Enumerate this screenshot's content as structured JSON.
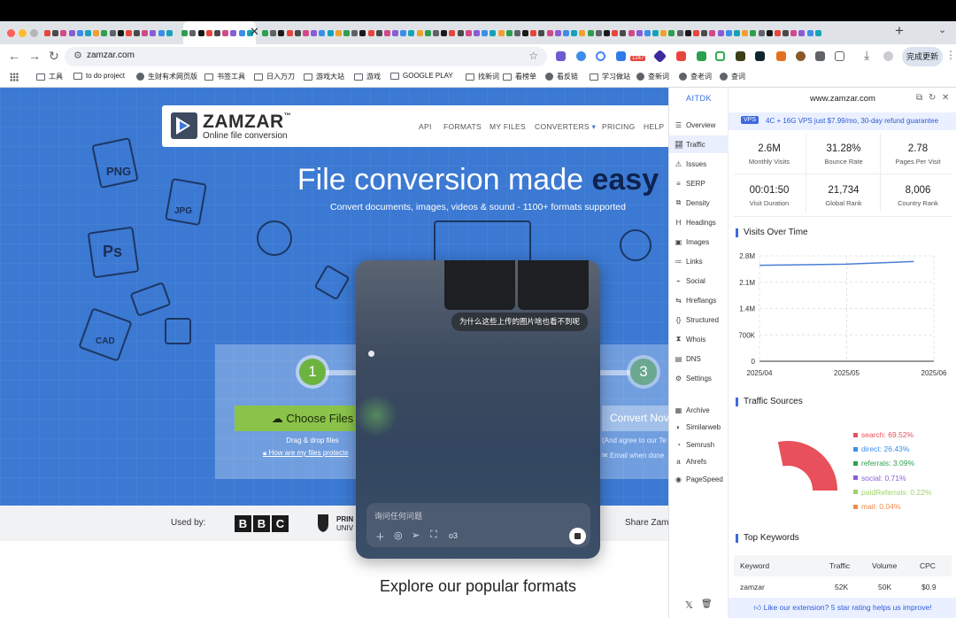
{
  "browser": {
    "url": "zamzar.com",
    "update_button": "完成更新",
    "ext_badge": "1247",
    "bookmarks": [
      {
        "label": "工具",
        "icon": "folder-icon"
      },
      {
        "label": "to do project",
        "icon": "folder-icon"
      },
      {
        "label": "生财有术网页版",
        "icon": "globe-icon"
      },
      {
        "label": "书签工具",
        "icon": "folder-icon"
      },
      {
        "label": "日入万刀",
        "icon": "folder-icon"
      },
      {
        "label": "游戏大站",
        "icon": "folder-icon"
      },
      {
        "label": "游戏",
        "icon": "folder-icon"
      },
      {
        "label": "GOOGLE PLAY",
        "icon": "folder-icon"
      },
      {
        "label": "找新词",
        "icon": "folder-icon"
      },
      {
        "label": "看榜单",
        "icon": "folder-icon"
      },
      {
        "label": "看反链",
        "icon": "globe-icon"
      },
      {
        "label": "学习做站",
        "icon": "folder-icon"
      },
      {
        "label": "查新词",
        "icon": "globe-icon"
      },
      {
        "label": "查老词",
        "icon": "globe-icon"
      },
      {
        "label": "查词",
        "icon": "globe-icon"
      }
    ]
  },
  "zamzar": {
    "logo": "ZAMZAR",
    "logo_tm": "™",
    "logo_sub": "Online file conversion",
    "nav": [
      "API",
      "FORMATS",
      "MY FILES",
      "CONVERTERS",
      "PRICING",
      "HELP"
    ],
    "hero_title": "File conversion made",
    "hero_title_bold": "easy",
    "hero_sub": "Convert documents, images, videos & sound - 1100+ formats supported",
    "doodles": [
      "PNG",
      "JPG",
      "Ps",
      "CAD"
    ],
    "step1": "1",
    "step3": "3",
    "choose_files": "Choose Files",
    "drag_drop": "Drag & drop files",
    "how_protected": "How are my files protecte",
    "convert_now": "Convert Nov",
    "agree": "(And agree to our Te",
    "email_when_done": "Email when done",
    "used_by": "Used by:",
    "bbc": [
      "B",
      "B",
      "C"
    ],
    "princeton_1": "PRIN",
    "princeton_2": "UNIV",
    "share": "Share Zam",
    "explore": "Explore our popular formats"
  },
  "overlay": {
    "bubble": "为什么这些上传的图片啥也看不到呢",
    "placeholder": "询问任何问题",
    "model": "o3"
  },
  "aitdk": {
    "brand": "AITDK",
    "domain": "www.zamzar.com",
    "vps_tag": "VPS",
    "vps_text": "4C + 16G VPS just $7.99/mo, 30-day refund guarantee",
    "nav": [
      {
        "label": "Overview",
        "icon": "overview-icon"
      },
      {
        "label": "Traffic",
        "icon": "traffic-icon"
      },
      {
        "label": "Issues",
        "icon": "warning-icon"
      },
      {
        "label": "SERP",
        "icon": "serp-icon"
      },
      {
        "label": "Density",
        "icon": "density-icon"
      },
      {
        "label": "Headings",
        "icon": "heading-icon"
      },
      {
        "label": "Images",
        "icon": "image-icon"
      },
      {
        "label": "Links",
        "icon": "link-icon"
      },
      {
        "label": "Social",
        "icon": "social-icon"
      },
      {
        "label": "Hreflangs",
        "icon": "language-icon"
      },
      {
        "label": "Structured",
        "icon": "braces-icon"
      },
      {
        "label": "Whois",
        "icon": "whois-icon"
      },
      {
        "label": "DNS",
        "icon": "dns-icon"
      },
      {
        "label": "Settings",
        "icon": "gear-icon"
      }
    ],
    "nav2": [
      {
        "label": "Archive",
        "icon": "archive-icon"
      },
      {
        "label": "Similarweb",
        "icon": "similarweb-icon"
      },
      {
        "label": "Semrush",
        "icon": "semrush-icon"
      },
      {
        "label": "Ahrefs",
        "icon": "ahrefs-icon"
      },
      {
        "label": "PageSpeed",
        "icon": "pagespeed-icon"
      }
    ],
    "stats": [
      {
        "value": "2.6M",
        "label": "Monthly Visits"
      },
      {
        "value": "31.28%",
        "label": "Bounce Rate"
      },
      {
        "value": "2.78",
        "label": "Pages Per Visit"
      },
      {
        "value": "00:01:50",
        "label": "Visit Duration"
      },
      {
        "value": "21,734",
        "label": "Global Rank"
      },
      {
        "value": "8,006",
        "label": "Country Rank"
      }
    ],
    "visits_title": "Visits Over Time",
    "sources_title": "Traffic Sources",
    "keywords_title": "Top Keywords",
    "kw_headers": [
      "Keyword",
      "Traffic",
      "Volume",
      "CPC"
    ],
    "kw_rows": [
      [
        "zamzar",
        "52K",
        "50K",
        "$0.9"
      ]
    ],
    "rate_text": "Like our extension? 5 star rating helps us improve!"
  },
  "chart_data": [
    {
      "type": "line",
      "x": [
        "2025/04",
        "2025/05",
        "2025/06"
      ],
      "points": [
        {
          "x": "2025-04-01",
          "y": 2550000
        },
        {
          "x": "2025-05-01",
          "y": 2580000
        },
        {
          "x": "2025-05-25",
          "y": 2650000
        }
      ],
      "yticks": [
        "0",
        "700K",
        "1.4M",
        "2.1M",
        "2.8M"
      ],
      "ylim": [
        0,
        2800000
      ],
      "color": "#4a7fd6",
      "grid": true
    },
    {
      "type": "pie",
      "labels": [
        "search",
        "direct",
        "referrals",
        "social",
        "paidReferrals",
        "mail"
      ],
      "values": [
        69.52,
        26.43,
        3.09,
        0.71,
        0.22,
        0.04
      ],
      "legend_text": [
        "search: 69.52%",
        "direct: 26.43%",
        "referrals: 3.09%",
        "social: 0.71%",
        "paidReferrals: 0.22%",
        "mail: 0.04%"
      ],
      "colors": [
        "#e8505b",
        "#3c8ee8",
        "#2e9f4d",
        "#8a5cd6",
        "#9ed36a",
        "#f08a4b"
      ],
      "legend": "right"
    }
  ]
}
